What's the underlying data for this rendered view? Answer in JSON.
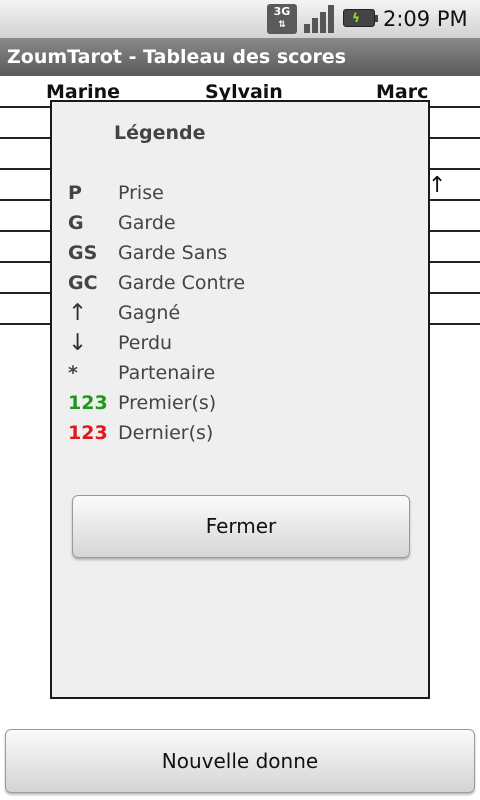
{
  "status_bar": {
    "network": "3G",
    "network_arrows": "⇅",
    "clock": "2:09 PM"
  },
  "title_bar": {
    "title": "ZoumTarot - Tableau des scores"
  },
  "score_table": {
    "players": [
      "Marine",
      "Sylvain",
      "Marc"
    ]
  },
  "dialog": {
    "title": "Légende",
    "legend": [
      {
        "code": "P",
        "label": "Prise"
      },
      {
        "code": "G",
        "label": "Garde"
      },
      {
        "code": "GS",
        "label": "Garde Sans"
      },
      {
        "code": "GC",
        "label": "Garde Contre"
      },
      {
        "code": "↑",
        "label": "Gagné"
      },
      {
        "code": "↓",
        "label": "Perdu"
      },
      {
        "code": "*",
        "label": "Partenaire"
      },
      {
        "code": "123",
        "label": "Premier(s)",
        "color": "#1a9a1a"
      },
      {
        "code": "123",
        "label": "Dernier(s)",
        "color": "#e01818"
      }
    ],
    "close_label": "Fermer"
  },
  "bottom_button": {
    "label": "Nouvelle donne"
  },
  "colors": {
    "title_bar": "#6e6e6e",
    "first_color": "#1a9a1a",
    "last_color": "#e01818",
    "dialog_bg": "#efefef"
  }
}
